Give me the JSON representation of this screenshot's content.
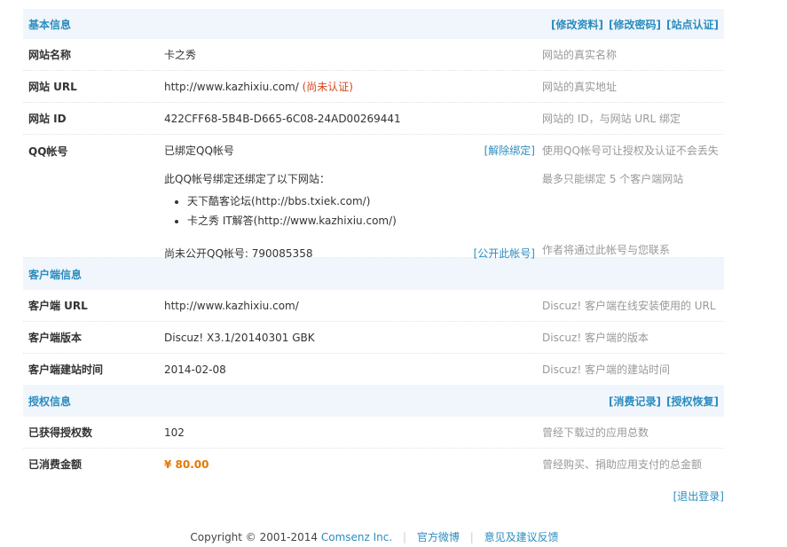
{
  "basic": {
    "title": "基本信息",
    "links": [
      "[修改资料]",
      "[修改密码]",
      "[站点认证]"
    ],
    "rows": [
      {
        "label": "网站名称",
        "value": "卡之秀",
        "note": "网站的真实名称"
      },
      {
        "label": "网站 URL",
        "value": "http://www.kazhixiu.com/",
        "status": "(尚未认证)",
        "note": "网站的真实地址"
      },
      {
        "label": "网站 ID",
        "value": "422CFF68-5B4B-D665-6C08-24AD00269441",
        "note": "网站的 ID，与网站 URL 绑定"
      }
    ],
    "qq": {
      "label": "QQ帐号",
      "bound": "已绑定QQ帐号",
      "unbind": "[解除绑定]",
      "note1": "使用QQ帐号可让授权及认证不会丢失",
      "also": "此QQ帐号绑定还绑定了以下网站：",
      "note2": "最多只能绑定 5 个客户端网站",
      "sites": [
        "天下酷客论坛(http://bbs.txiek.com/)",
        "卡之秀 IT解答(http://www.kazhixiu.com/)"
      ],
      "public": "尚未公开QQ帐号: 790085358",
      "publish": "[公开此帐号]",
      "note3": "作者将通过此帐号与您联系"
    }
  },
  "client": {
    "title": "客户端信息",
    "rows": [
      {
        "label": "客户端 URL",
        "value": "http://www.kazhixiu.com/",
        "note": "Discuz! 客户端在线安装使用的 URL"
      },
      {
        "label": "客户端版本",
        "value": "Discuz! X3.1/20140301 GBK",
        "note": "Discuz! 客户端的版本"
      },
      {
        "label": "客户端建站时间",
        "value": "2014-02-08",
        "note": "Discuz! 客户端的建站时间"
      }
    ]
  },
  "license": {
    "title": "授权信息",
    "links": [
      "[消费记录]",
      "[授权恢复]"
    ],
    "rows": [
      {
        "label": "已获得授权数",
        "value": "102",
        "note": "曾经下载过的应用总数"
      },
      {
        "label": "已消费金额",
        "value": "¥ 80.00",
        "note": "曾经购买、捐助应用支付的总金额"
      }
    ]
  },
  "logout": "[退出登录]",
  "footer": {
    "copyright": "Copyright © 2001-2014",
    "company": "Comsenz Inc.",
    "weibo": "官方微博",
    "feedback": "意见及建议反馈",
    "sep": "|"
  }
}
